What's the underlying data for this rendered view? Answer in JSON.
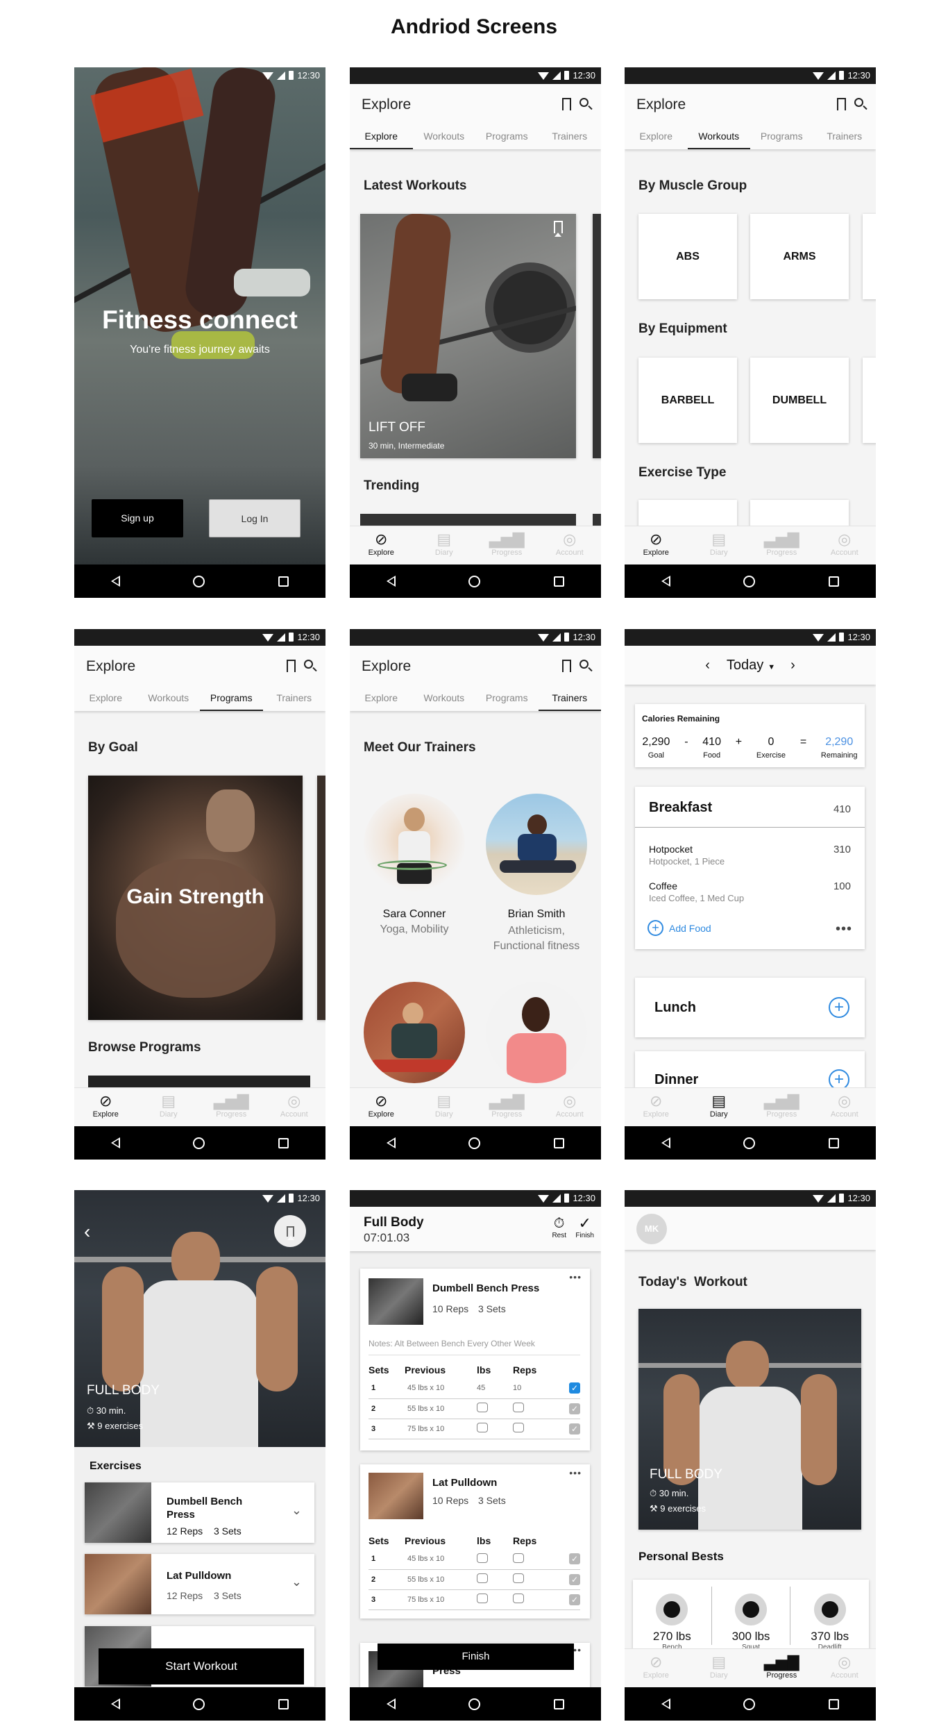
{
  "page_title": "Andriod Screens",
  "status_time": "12:30",
  "tabs": [
    "Explore",
    "Workouts",
    "Programs",
    "Trainers"
  ],
  "nav": [
    "Explore",
    "Diary",
    "Progress",
    "Account"
  ],
  "icons": {
    "back": "back-icon",
    "home": "home-icon",
    "recents": "recents-icon",
    "bookmark": "bookmark-icon",
    "search": "search-icon"
  },
  "s1": {
    "title": "Fitness connect",
    "subtitle": "You're fitness journey awaits",
    "signup": "Sign up",
    "login": "Log In"
  },
  "s2": {
    "title": "Explore",
    "section1": "Latest Workouts",
    "card_title": "LIFT OFF",
    "card_sub": "30 min, Intermediate",
    "section2": "Trending"
  },
  "s3": {
    "title": "Explore",
    "by_muscle": "By Muscle Group",
    "muscles": [
      "ABS",
      "ARMS"
    ],
    "by_equipment": "By Equipment",
    "equipment": [
      "BARBELL",
      "DUMBELL"
    ],
    "exercise_type": "Exercise Type"
  },
  "s4": {
    "title": "Explore",
    "by_goal": "By Goal",
    "goal_card": "Gain Strength",
    "browse": "Browse Programs"
  },
  "s5": {
    "title": "Explore",
    "heading": "Meet Our Trainers",
    "trainers": [
      {
        "name": "Sara Conner",
        "specialty": "Yoga, Mobility"
      },
      {
        "name": "Brian Smith",
        "specialty": "Athleticism, Functional fitness"
      }
    ]
  },
  "s6": {
    "date": "Today",
    "calories_title": "Calories Remaining",
    "goal": "2,290",
    "food": "410",
    "exercise": "0",
    "remaining": "2,290",
    "goal_lbl": "Goal",
    "food_lbl": "Food",
    "exercise_lbl": "Exercise",
    "remaining_lbl": "Remaining",
    "minus": "-",
    "plus": "+",
    "equals": "=",
    "breakfast": "Breakfast",
    "breakfast_total": "410",
    "items": [
      {
        "name": "Hotpocket",
        "detail": "Hotpocket, 1 Piece",
        "cal": "310"
      },
      {
        "name": "Coffee",
        "detail": "Iced Coffee, 1 Med Cup",
        "cal": "100"
      }
    ],
    "add_food": "Add Food",
    "lunch": "Lunch",
    "dinner": "Dinner"
  },
  "s7": {
    "title": "FULL BODY",
    "duration": "30 min.",
    "exercises_count": "9 exercises",
    "exercises_heading": "Exercises",
    "exercises": [
      {
        "name": "Dumbell Bench Press",
        "reps": "12 Reps",
        "sets": "3 Sets"
      },
      {
        "name": "Lat Pulldown",
        "reps": "12 Reps",
        "sets": "3 Sets"
      }
    ],
    "start": "Start Workout"
  },
  "s8": {
    "title": "Full Body",
    "timer": "07:01.03",
    "rest": "Rest",
    "finish_icon_lbl": "Finish",
    "ex1": {
      "name": "Dumbell Bench Press",
      "reps": "10 Reps",
      "sets": "3 Sets",
      "notes": "Notes: Alt Between Bench Every Other Week"
    },
    "ex2": {
      "name": "Lat Pulldown",
      "reps": "10 Reps",
      "sets": "3 Sets"
    },
    "cols": [
      "Sets",
      "Previous",
      "lbs",
      "Reps"
    ],
    "rows1": [
      {
        "set": "1",
        "prev": "45 lbs x 10",
        "lbs": "45",
        "reps": "10"
      },
      {
        "set": "2",
        "prev": "55 lbs x 10",
        "lbs": "",
        "reps": ""
      },
      {
        "set": "3",
        "prev": "75 lbs x 10",
        "lbs": "",
        "reps": ""
      }
    ],
    "rows2": [
      {
        "set": "1",
        "prev": "45 lbs x 10"
      },
      {
        "set": "2",
        "prev": "55 lbs x 10"
      },
      {
        "set": "3",
        "prev": "75 lbs x 10"
      }
    ],
    "finish": "Finish",
    "ex3_partial": "Press"
  },
  "s9": {
    "avatar": "MK",
    "heading": "Today's  Workout",
    "card_title": "FULL BODY",
    "duration": "30 min.",
    "exercises_count": "9 exercises",
    "pb_heading": "Personal Bests",
    "pbs": [
      {
        "value": "270 lbs",
        "label": "Bench"
      },
      {
        "value": "300 lbs",
        "label": "Squat"
      },
      {
        "value": "370 lbs",
        "label": "Deadlift"
      }
    ]
  }
}
